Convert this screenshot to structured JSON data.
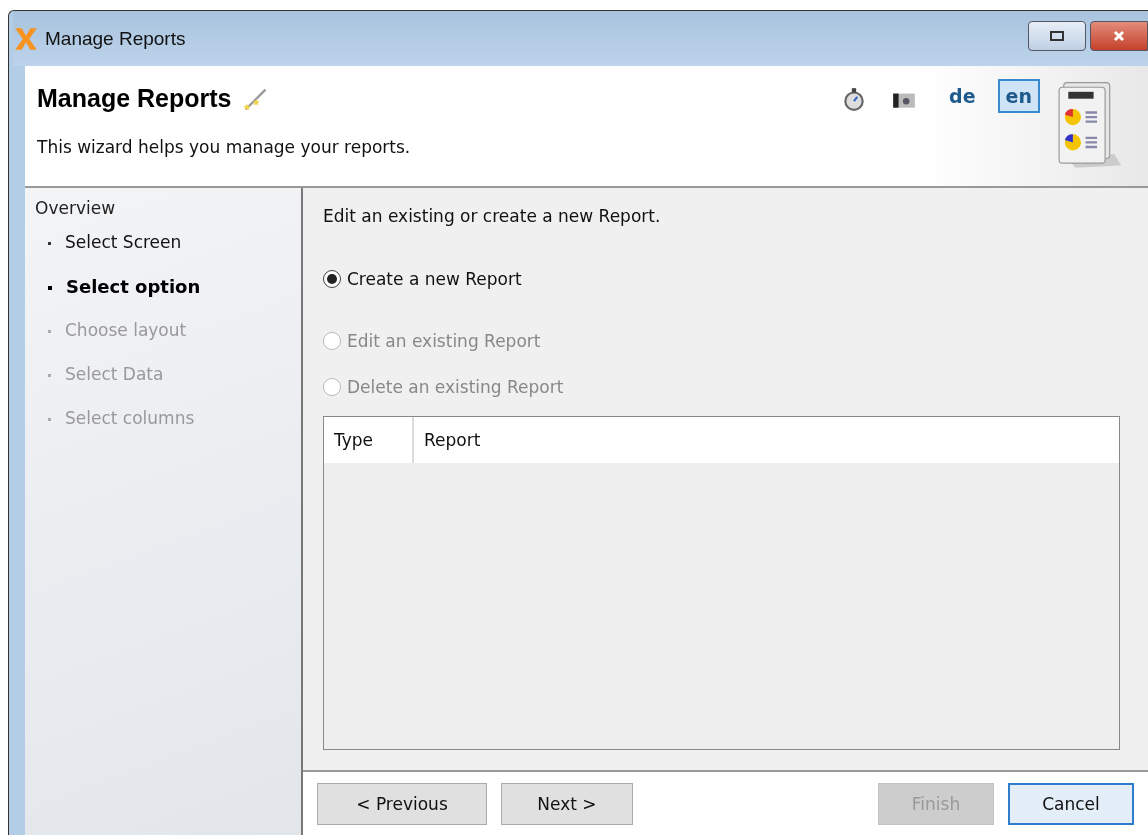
{
  "window": {
    "title": "Manage Reports"
  },
  "header": {
    "title": "Manage Reports",
    "subtitle": "This wizard helps you manage your reports.",
    "languages": [
      {
        "label": "de",
        "selected": false
      },
      {
        "label": "en",
        "selected": true
      }
    ]
  },
  "sidebar": {
    "title": "Overview",
    "steps": [
      {
        "label": "Select Screen",
        "selected": false,
        "disabled": false
      },
      {
        "label": "Select option",
        "selected": true,
        "disabled": false
      },
      {
        "label": "Choose layout",
        "selected": false,
        "disabled": true
      },
      {
        "label": "Select Data",
        "selected": false,
        "disabled": true
      },
      {
        "label": "Select columns",
        "selected": false,
        "disabled": true
      }
    ]
  },
  "content": {
    "instruction": "Edit an existing or create a new Report.",
    "options": [
      {
        "label": "Create a new Report",
        "selected": true,
        "disabled": false
      },
      {
        "label": "Edit an existing Report",
        "selected": false,
        "disabled": true
      },
      {
        "label": "Delete an existing Report",
        "selected": false,
        "disabled": true
      }
    ],
    "table": {
      "columns": [
        "Type",
        "Report"
      ]
    }
  },
  "buttons": [
    {
      "label": "< Previous",
      "disabled": false,
      "focused": false
    },
    {
      "label": "Next >",
      "disabled": false,
      "focused": false
    },
    {
      "label": "Finish",
      "disabled": true,
      "focused": false
    },
    {
      "label": "Cancel",
      "disabled": false,
      "focused": true
    }
  ]
}
